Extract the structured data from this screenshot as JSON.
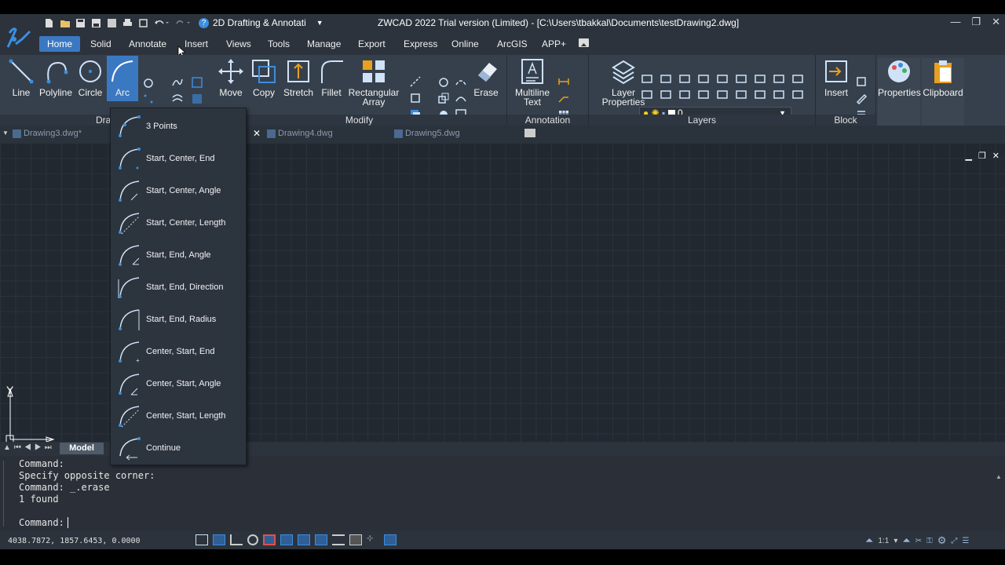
{
  "titlebar": {
    "workspace": "2D Drafting & Annotati",
    "title": "ZWCAD 2022 Trial version (Limited) - [C:\\Users\\tbakkal\\Documents\\testDrawing2.dwg]",
    "min": "—",
    "max": "❐",
    "close": "✕"
  },
  "menu": {
    "tabs": [
      "Home",
      "Solid",
      "Annotate",
      "Insert",
      "Views",
      "Tools",
      "Manage",
      "Export",
      "Express",
      "Online",
      "ArcGIS",
      "APP+"
    ]
  },
  "ribbon": {
    "draw": {
      "title": "Dra",
      "line": "Line",
      "polyline": "Polyline",
      "circle": "Circle",
      "arc": "Arc"
    },
    "modify": {
      "title": "Modify",
      "move": "Move",
      "copy": "Copy",
      "stretch": "Stretch",
      "fillet": "Fillet",
      "array1": "Rectangular",
      "array2": "Array",
      "erase": "Erase"
    },
    "annotation": {
      "title": "Annotation",
      "mtext1": "Multiline",
      "mtext2": "Text"
    },
    "layers": {
      "title": "Layers",
      "props1": "Layer",
      "props2": "Properties",
      "current": "0"
    },
    "block": {
      "title": "Block",
      "insert": "Insert"
    },
    "properties": "Properties",
    "clipboard": "Clipboard"
  },
  "doctabs": [
    "Drawing3.dwg*",
    "Drawing4.dwg",
    "Drawing5.dwg"
  ],
  "arc_menu": [
    "3 Points",
    "Start, Center, End",
    "Start, Center, Angle",
    "Start, Center, Length",
    "Start, End, Angle",
    "Start, End, Direction",
    "Start, End, Radius",
    "Center, Start,  End",
    "Center, Start,  Angle",
    "Center, Start, Length",
    "Continue"
  ],
  "ucs": {
    "x": "X",
    "y": "Y"
  },
  "layout": {
    "model": "Model"
  },
  "command": {
    "history": [
      "Command:",
      "Specify opposite corner:",
      "Command: _.erase",
      "1 found"
    ],
    "prompt": "Command:"
  },
  "status": {
    "coords": "4038.7872, 1857.6453, 0.0000",
    "scale": "1:1"
  },
  "colors": {
    "accent": "#3b78c2",
    "background": "#212830",
    "grid": "#2a323b"
  }
}
